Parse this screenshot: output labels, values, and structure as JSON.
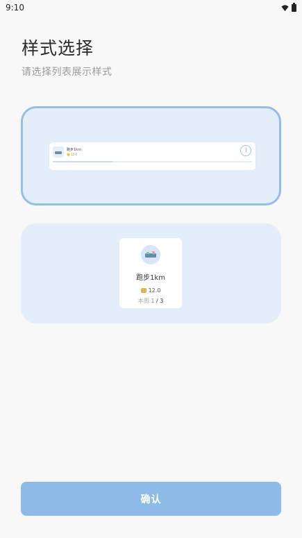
{
  "status_bar": {
    "time": "9:10"
  },
  "header": {
    "title": "样式选择",
    "subtitle": "请选择列表展示样式"
  },
  "options": {
    "list_style": {
      "selected": true,
      "preview": {
        "name": "跑步1km",
        "coins": "12.0",
        "progress": 0.3
      }
    },
    "grid_style": {
      "selected": false,
      "preview": {
        "name": "跑步1km",
        "coins": "12.0",
        "period_label": "本周:",
        "period_current": "1",
        "period_separator": " / ",
        "period_total": "3"
      }
    }
  },
  "footer": {
    "confirm_label": "确认"
  },
  "colors": {
    "accent": "#8fbbe9",
    "card_bg": "#e4eefb",
    "selected_border": "#95bde8"
  }
}
